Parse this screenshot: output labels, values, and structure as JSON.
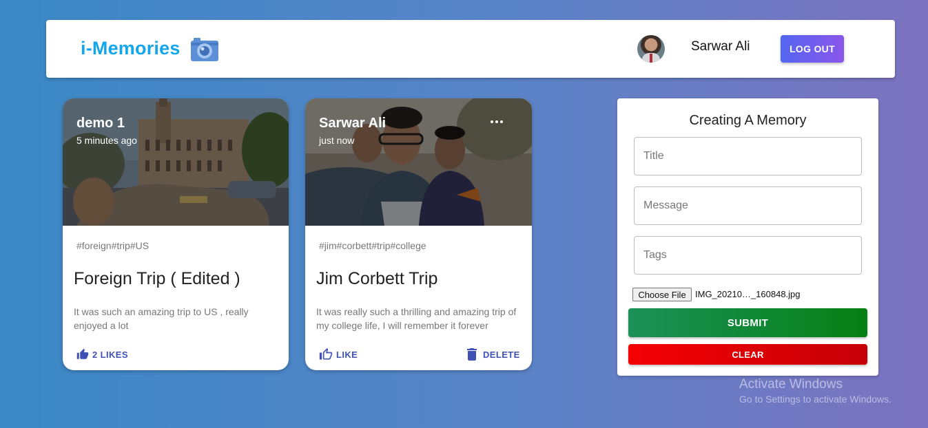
{
  "header": {
    "brand": "i-Memories",
    "brand_icon": "camera-icon",
    "user_name": "Sarwar Ali",
    "logout_label": "LOG OUT"
  },
  "posts": [
    {
      "author": "demo 1",
      "time": "5 minutes ago",
      "tags": "#foreign#trip#US",
      "title": "Foreign Trip ( Edited )",
      "message": "It was such an amazing trip to US , really enjoyed a lot",
      "like_label": "2 LIKES",
      "image": "city-street-classic-car-photo"
    },
    {
      "author": "Sarwar Ali",
      "time": "just now",
      "tags": "#jim#corbett#trip#college",
      "title": "Jim Corbett Trip",
      "message": "It was really such a thrilling and amazing trip of my college life, I will remember it forever",
      "like_label": "LIKE",
      "delete_label": "DELETE",
      "image": "group-selfie-photo"
    }
  ],
  "form": {
    "title": "Creating A Memory",
    "title_placeholder": "Title",
    "message_placeholder": "Message",
    "tags_placeholder": "Tags",
    "file_button": "Choose File",
    "file_name": "IMG_20210…_160848.jpg",
    "submit_label": "SUBMIT",
    "clear_label": "CLEAR"
  },
  "watermark": {
    "title": "Activate Windows",
    "subtitle": "Go to Settings to activate Windows."
  },
  "colors": {
    "brand": "#14a6ec",
    "primary": "#3f51b5",
    "submit": "#068014",
    "clear": "#f40003"
  }
}
